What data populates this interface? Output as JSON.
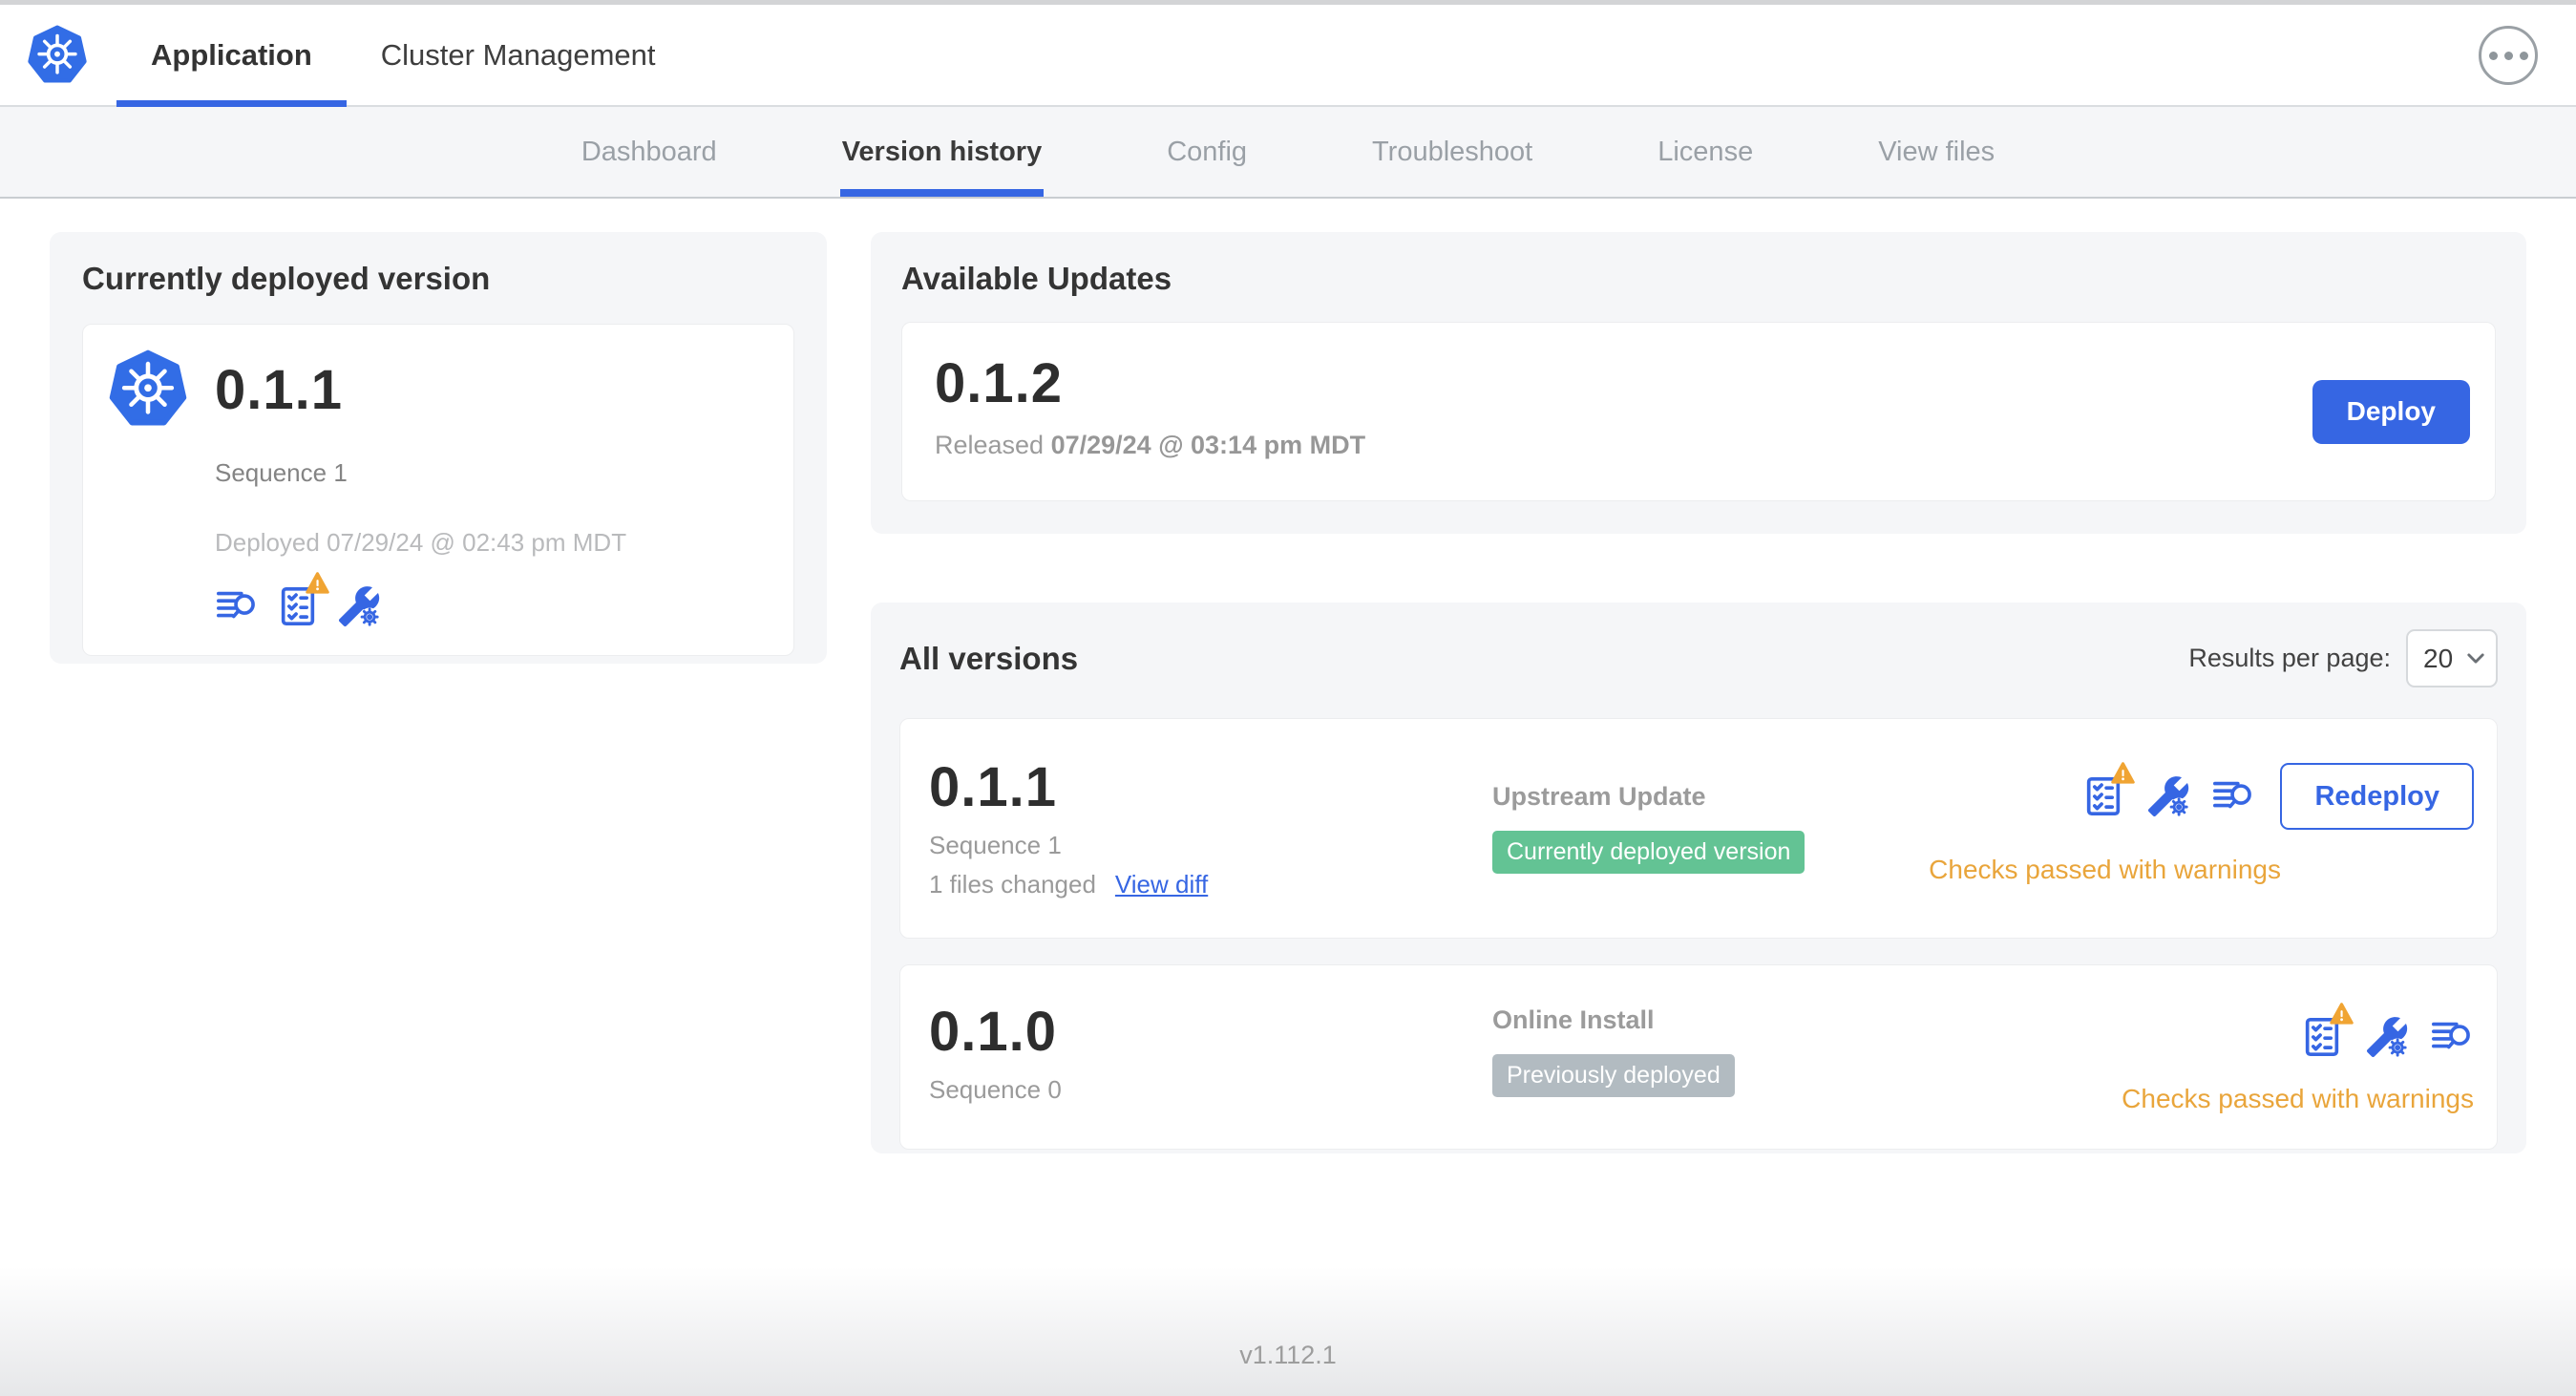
{
  "header": {
    "tabs": [
      {
        "label": "Application",
        "active": true
      },
      {
        "label": "Cluster Management",
        "active": false
      }
    ],
    "menu_icon": "ellipsis-menu-icon"
  },
  "subnav": {
    "tabs": [
      {
        "label": "Dashboard",
        "active": false
      },
      {
        "label": "Version history",
        "active": true
      },
      {
        "label": "Config",
        "active": false
      },
      {
        "label": "Troubleshoot",
        "active": false
      },
      {
        "label": "License",
        "active": false
      },
      {
        "label": "View files",
        "active": false
      }
    ]
  },
  "current_version": {
    "title": "Currently deployed version",
    "version": "0.1.1",
    "sequence": "Sequence 1",
    "deployed": "Deployed 07/29/24 @ 02:43 pm MDT",
    "icons": [
      "release-notes-icon",
      "preflight-checks-warning-icon",
      "config-icon"
    ]
  },
  "available_updates": {
    "title": "Available Updates",
    "version": "0.1.2",
    "released_prefix": "Released",
    "released_date": "07/29/24 @ 03:14 pm MDT",
    "deploy_label": "Deploy"
  },
  "all_versions": {
    "title": "All versions",
    "results_per_page_label": "Results per page:",
    "results_per_page_value": "20",
    "rows": [
      {
        "version": "0.1.1",
        "sequence": "Sequence 1",
        "files_changed": "1 files changed",
        "view_diff": "View diff",
        "source": "Upstream Update",
        "badge": "Currently deployed version",
        "badge_type": "green",
        "icons": [
          "preflight-checks-warning-icon",
          "config-icon",
          "release-notes-icon"
        ],
        "checks": "Checks passed with warnings",
        "action": "Redeploy"
      },
      {
        "version": "0.1.0",
        "sequence": "Sequence 0",
        "source": "Online Install",
        "badge": "Previously deployed",
        "badge_type": "gray",
        "icons": [
          "preflight-checks-warning-icon",
          "config-icon",
          "release-notes-icon"
        ],
        "checks": "Checks passed with warnings"
      }
    ]
  },
  "footer": {
    "version": "v1.112.1"
  },
  "colors": {
    "accent_blue": "#3666e3",
    "logo_blue": "#326de6",
    "badge_green": "#63c394",
    "badge_gray": "#b2bbc1",
    "warning_amber": "#e9a53b",
    "panel_bg": "#f5f6f8"
  }
}
